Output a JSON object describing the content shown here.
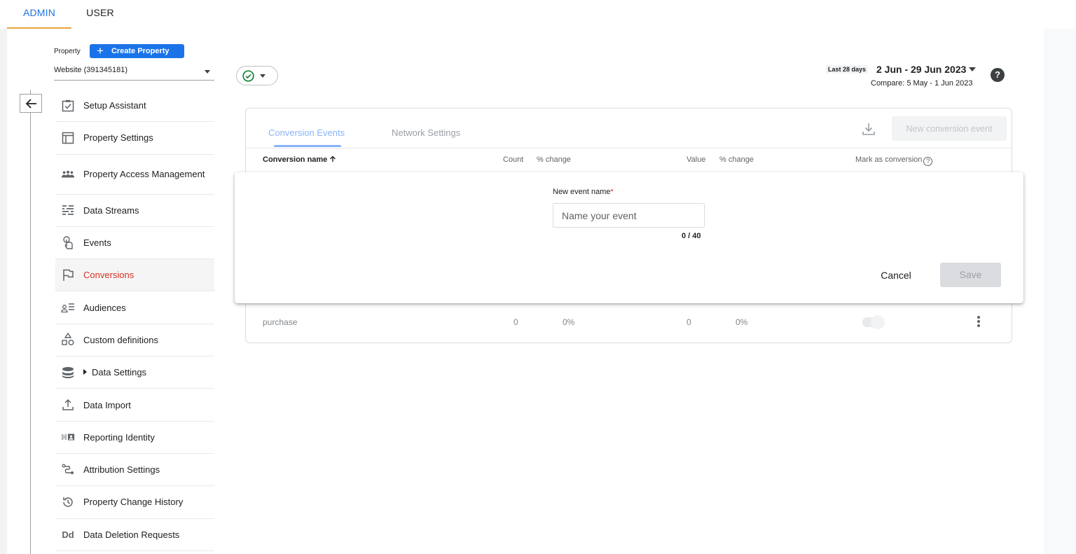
{
  "top_tabs": {
    "admin": "ADMIN",
    "user": "USER"
  },
  "property": {
    "label": "Property",
    "create_button": "Create Property",
    "selected": "Website (391345181)"
  },
  "sidebar": {
    "items": [
      {
        "label": "Setup Assistant",
        "icon": "checklist-icon"
      },
      {
        "label": "Property Settings",
        "icon": "window-icon"
      },
      {
        "label": "Property Access Management",
        "icon": "people-icon"
      },
      {
        "label": "Data Streams",
        "icon": "streams-icon"
      },
      {
        "label": "Events",
        "icon": "touch-icon"
      },
      {
        "label": "Conversions",
        "icon": "flag-icon",
        "active": true
      },
      {
        "label": "Audiences",
        "icon": "audience-icon"
      },
      {
        "label": "Custom definitions",
        "icon": "shapes-icon"
      },
      {
        "label": "Data Settings",
        "icon": "database-icon"
      },
      {
        "label": "Data Import",
        "icon": "upload-icon"
      },
      {
        "label": "Reporting Identity",
        "icon": "identity-icon"
      },
      {
        "label": "Attribution Settings",
        "icon": "attribution-icon"
      },
      {
        "label": "Property Change History",
        "icon": "history-icon"
      },
      {
        "label": "Data Deletion Requests",
        "icon": "dd-icon",
        "icon_text": "Dd"
      }
    ]
  },
  "date": {
    "badge": "Last 28 days",
    "range": "2 Jun - 29 Jun 2023",
    "compare": "Compare: 5 May - 1 Jun 2023"
  },
  "card": {
    "tabs": [
      "Conversion Events",
      "Network Settings"
    ],
    "new_button": "New conversion event",
    "columns": {
      "name": "Conversion name",
      "count": "Count",
      "pct_change_1": "% change",
      "value": "Value",
      "pct_change_2": "% change",
      "mark": "Mark as conversion"
    },
    "rows": [
      {
        "name": "purchase",
        "count": "0",
        "pct1": "0%",
        "value": "0",
        "pct2": "0%"
      }
    ]
  },
  "modal": {
    "label": "New event name",
    "required_mark": "*",
    "placeholder": "Name your event",
    "counter": "0 / 40",
    "cancel": "Cancel",
    "save": "Save"
  },
  "colors": {
    "primary": "#1a73e8",
    "tab_underline": "#e8a33d",
    "active_nav": "#d93025",
    "status_ok": "#188038"
  }
}
